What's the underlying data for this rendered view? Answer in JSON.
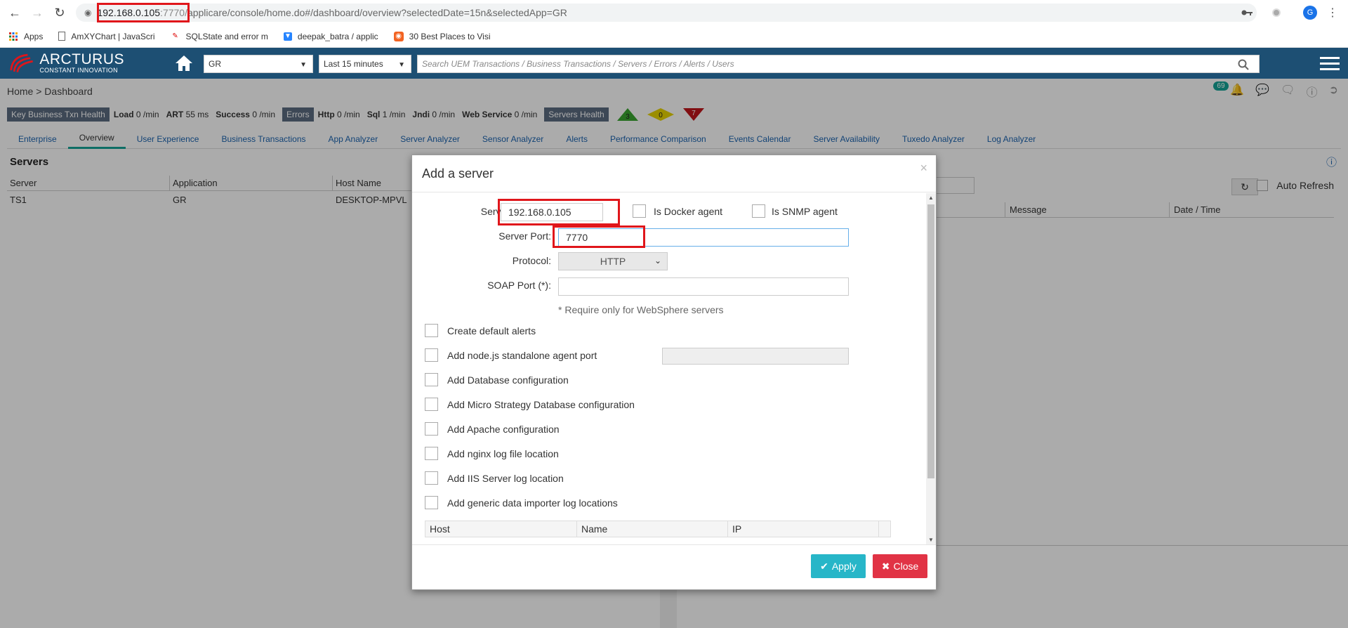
{
  "browser": {
    "url_host": "192.168.0.105",
    "url_port": ":7770",
    "url_slash": "/",
    "url_path": "applicare/console/home.do#/dashboard/overview?selectedDate=15n&selectedApp=GR",
    "profile_initial": "G"
  },
  "bookmarks": [
    {
      "label": "Apps",
      "icon": "apps-grid-icon"
    },
    {
      "label": "AmXYChart | JavaScri",
      "icon": "page-icon"
    },
    {
      "label": "SQLState and error m",
      "icon": "pen-icon"
    },
    {
      "label": "deepak_batra / applic",
      "icon": "bitbucket-icon"
    },
    {
      "label": "30 Best Places to Visi",
      "icon": "orange-icon"
    }
  ],
  "header": {
    "logo_title": "ARCTURUS",
    "logo_sub": "CONSTANT INNOVATION",
    "app_select": "GR",
    "time_select": "Last 15 minutes",
    "search_placeholder": "Search UEM Transactions / Business Transactions / Servers / Errors / Alerts / Users"
  },
  "page": {
    "breadcrumb": "Home > Dashboard",
    "notif_count": "69",
    "health": {
      "key_label": "Key Business Txn Health",
      "load_label": "Load",
      "load_val": "0 /min",
      "art_label": "ART",
      "art_val": "55 ms",
      "success_label": "Success",
      "success_val": "0 /min",
      "errors_label": "Errors",
      "http_label": "Http",
      "http_val": "0 /min",
      "sql_label": "Sql",
      "sql_val": "1 /min",
      "jndi_label": "Jndi",
      "jndi_val": "0 /min",
      "ws_label": "Web Service",
      "ws_val": "0 /min",
      "servers_label": "Servers Health",
      "green_count": "3",
      "yellow_count": "0",
      "red_count": "7",
      "colors": {
        "green": "#3aa630",
        "yellow": "#e8d400",
        "red": "#c0151c"
      }
    },
    "tabs": [
      "Enterprise",
      "Overview",
      "User Experience",
      "Business Transactions",
      "App Analyzer",
      "Server Analyzer",
      "Sensor Analyzer",
      "Alerts",
      "Performance Comparison",
      "Events Calendar",
      "Server Availability",
      "Tuxedo Analyzer",
      "Log Analyzer"
    ],
    "active_tab": "Overview",
    "servers_title": "Servers",
    "servers_columns": [
      "Server",
      "Application",
      "Host Name"
    ],
    "servers_rows": [
      [
        "TS1",
        "GR",
        "DESKTOP-MPVL"
      ]
    ],
    "right_columns": [
      "Message",
      "Date / Time"
    ],
    "auto_refresh": "Auto Refresh"
  },
  "modal": {
    "title": "Add a server",
    "server_ip_label": "Server IP:",
    "server_ip_value": "192.168.0.105",
    "docker_label": "Is Docker agent",
    "snmp_label": "Is SNMP agent",
    "server_port_label": "Server Port:",
    "server_port_value": "7770",
    "protocol_label": "Protocol:",
    "protocol_value": "HTTP",
    "soap_label": "SOAP Port (*):",
    "soap_note": "* Require only for WebSphere servers",
    "options": [
      "Create default alerts",
      "Add node.js standalone agent port",
      "Add Database configuration",
      "Add Micro Strategy Database configuration",
      "Add Apache configuration",
      "Add nginx log file location",
      "Add IIS Server log location",
      "Add generic data importer log locations"
    ],
    "table_columns": [
      "Host",
      "Name",
      "IP"
    ],
    "apply_label": "Apply",
    "close_label": "Close"
  },
  "colors": {
    "header_bg": "#1d4f73",
    "accent_teal": "#15a497",
    "apply": "#27b6c8",
    "close": "#e13345",
    "highlight_red": "#e0161b"
  }
}
